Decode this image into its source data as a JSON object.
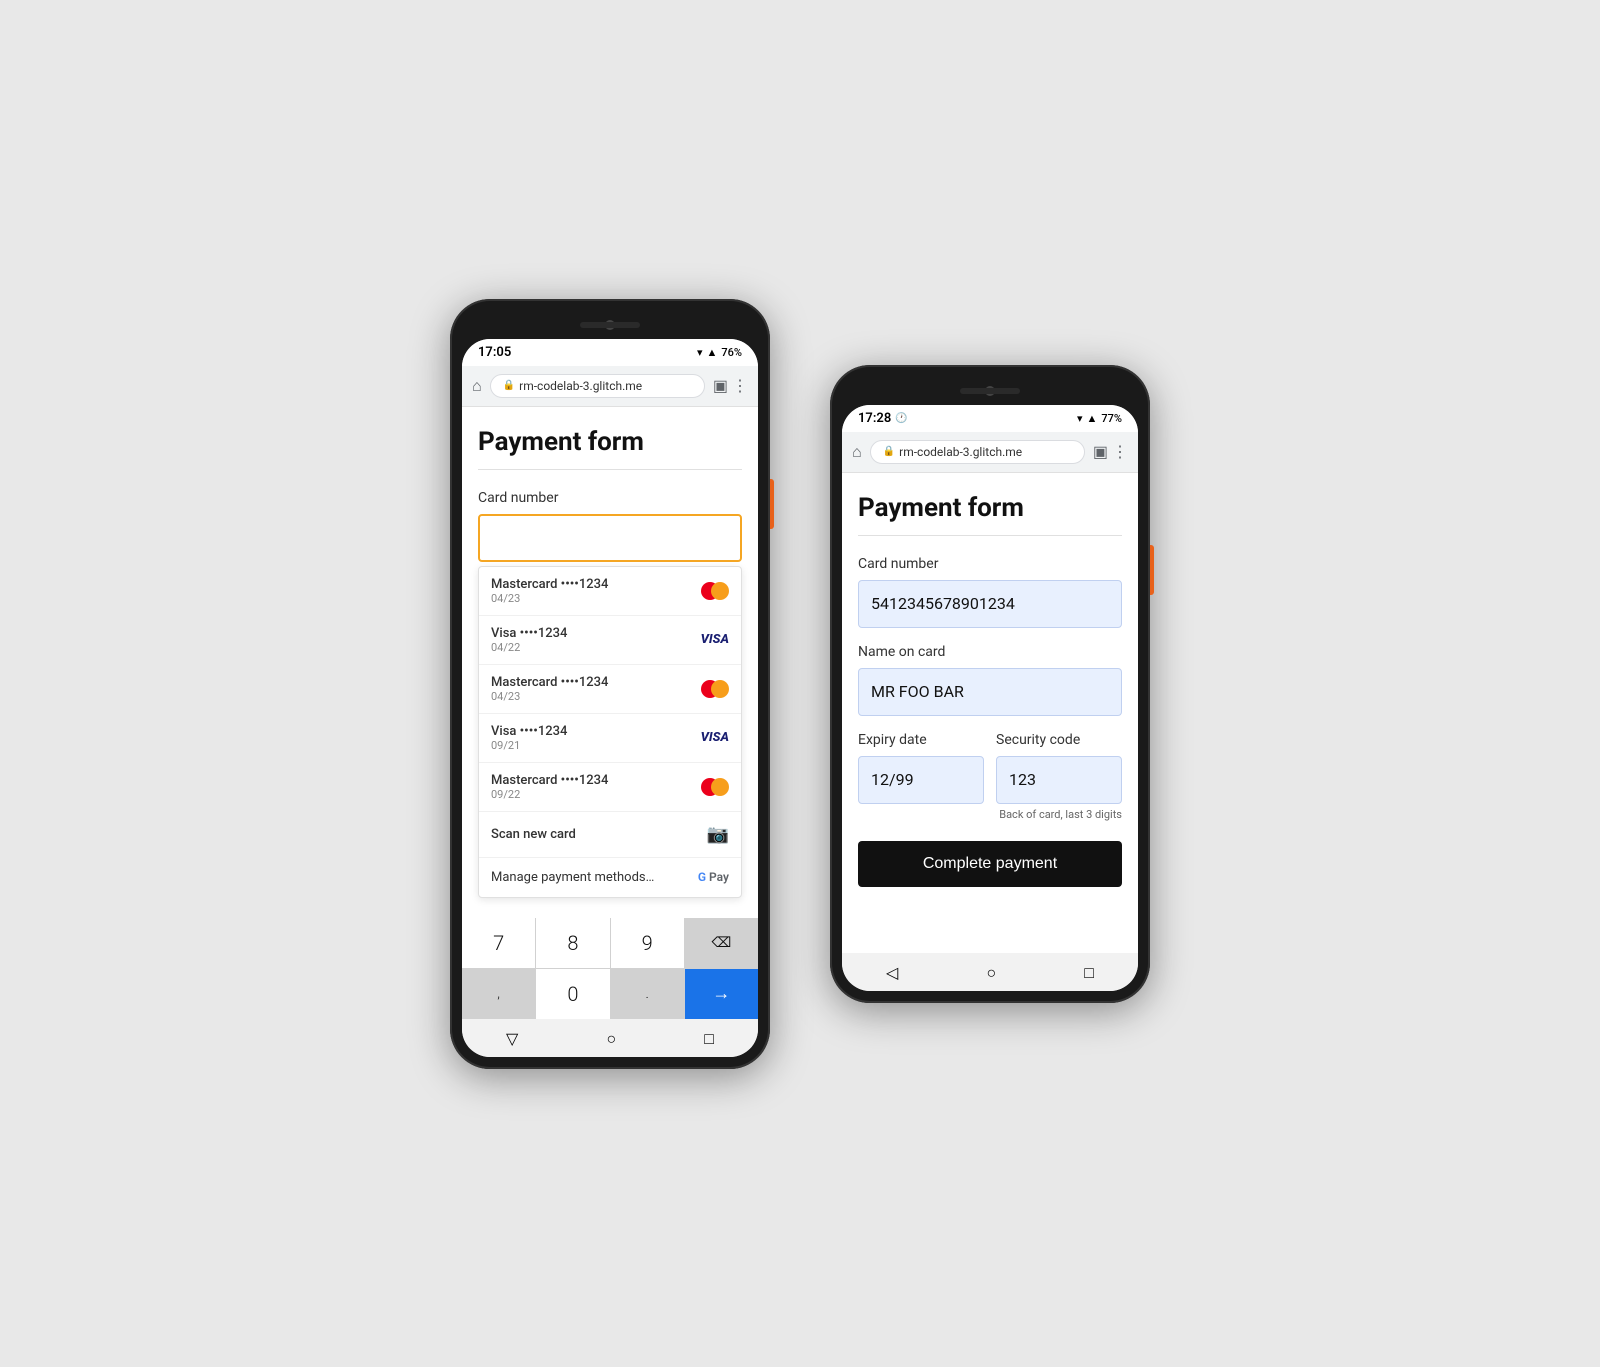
{
  "phone_left": {
    "status": {
      "time": "17:05",
      "battery": "76%",
      "url": "rm-codelab-3.glitch.me"
    },
    "page": {
      "title": "Payment form"
    },
    "card_number_label": "Card number",
    "cards": [
      {
        "type": "Mastercard",
        "dots": "••••1234",
        "expiry": "04/23",
        "logo": "mc"
      },
      {
        "type": "Visa",
        "dots": "••••1234",
        "expiry": "04/22",
        "logo": "visa"
      },
      {
        "type": "Mastercard",
        "dots": "••••1234",
        "expiry": "04/23",
        "logo": "mc"
      },
      {
        "type": "Visa",
        "dots": "••••1234",
        "expiry": "09/21",
        "logo": "visa"
      },
      {
        "type": "Mastercard",
        "dots": "••••1234",
        "expiry": "09/22",
        "logo": "mc"
      }
    ],
    "scan_label": "Scan new card",
    "manage_label": "Manage payment methods…",
    "keyboard": {
      "keys": [
        "7",
        "8",
        "9",
        "⌫",
        ",",
        "0",
        ".",
        "→"
      ]
    }
  },
  "phone_right": {
    "status": {
      "time": "17:28",
      "battery": "77%",
      "url": "rm-codelab-3.glitch.me"
    },
    "page": {
      "title": "Payment form"
    },
    "card_number_label": "Card number",
    "card_number_value": "5412345678901234",
    "name_label": "Name on card",
    "name_value": "MR FOO BAR",
    "expiry_label": "Expiry date",
    "expiry_value": "12/99",
    "security_label": "Security code",
    "security_value": "123",
    "security_hint": "Back of card, last 3 digits",
    "complete_button": "Complete payment"
  }
}
